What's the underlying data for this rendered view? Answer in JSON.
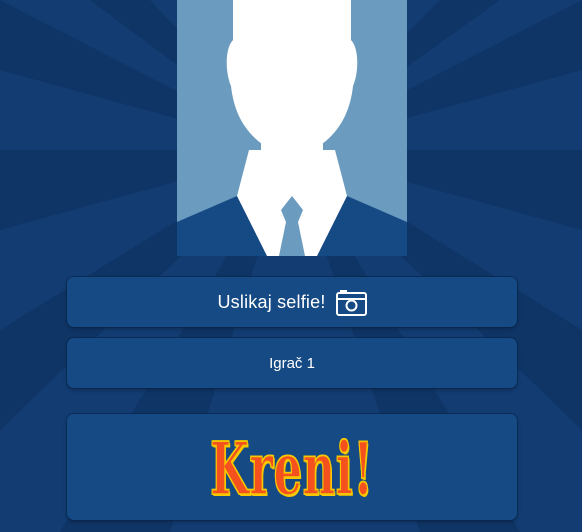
{
  "profile": {
    "avatar_icon": "person-silhouette-icon"
  },
  "selfie": {
    "label": "Uslikaj selfie!",
    "icon": "camera-icon"
  },
  "player": {
    "name_value": "Igrač 1"
  },
  "start": {
    "label": "Kreni!"
  },
  "colors": {
    "background": "#123c72",
    "panel": "#154a84",
    "avatar_bg": "#6b9bbf",
    "suit": "#154a84",
    "start_text": "#f4511e",
    "start_outline": "#f6c700"
  }
}
